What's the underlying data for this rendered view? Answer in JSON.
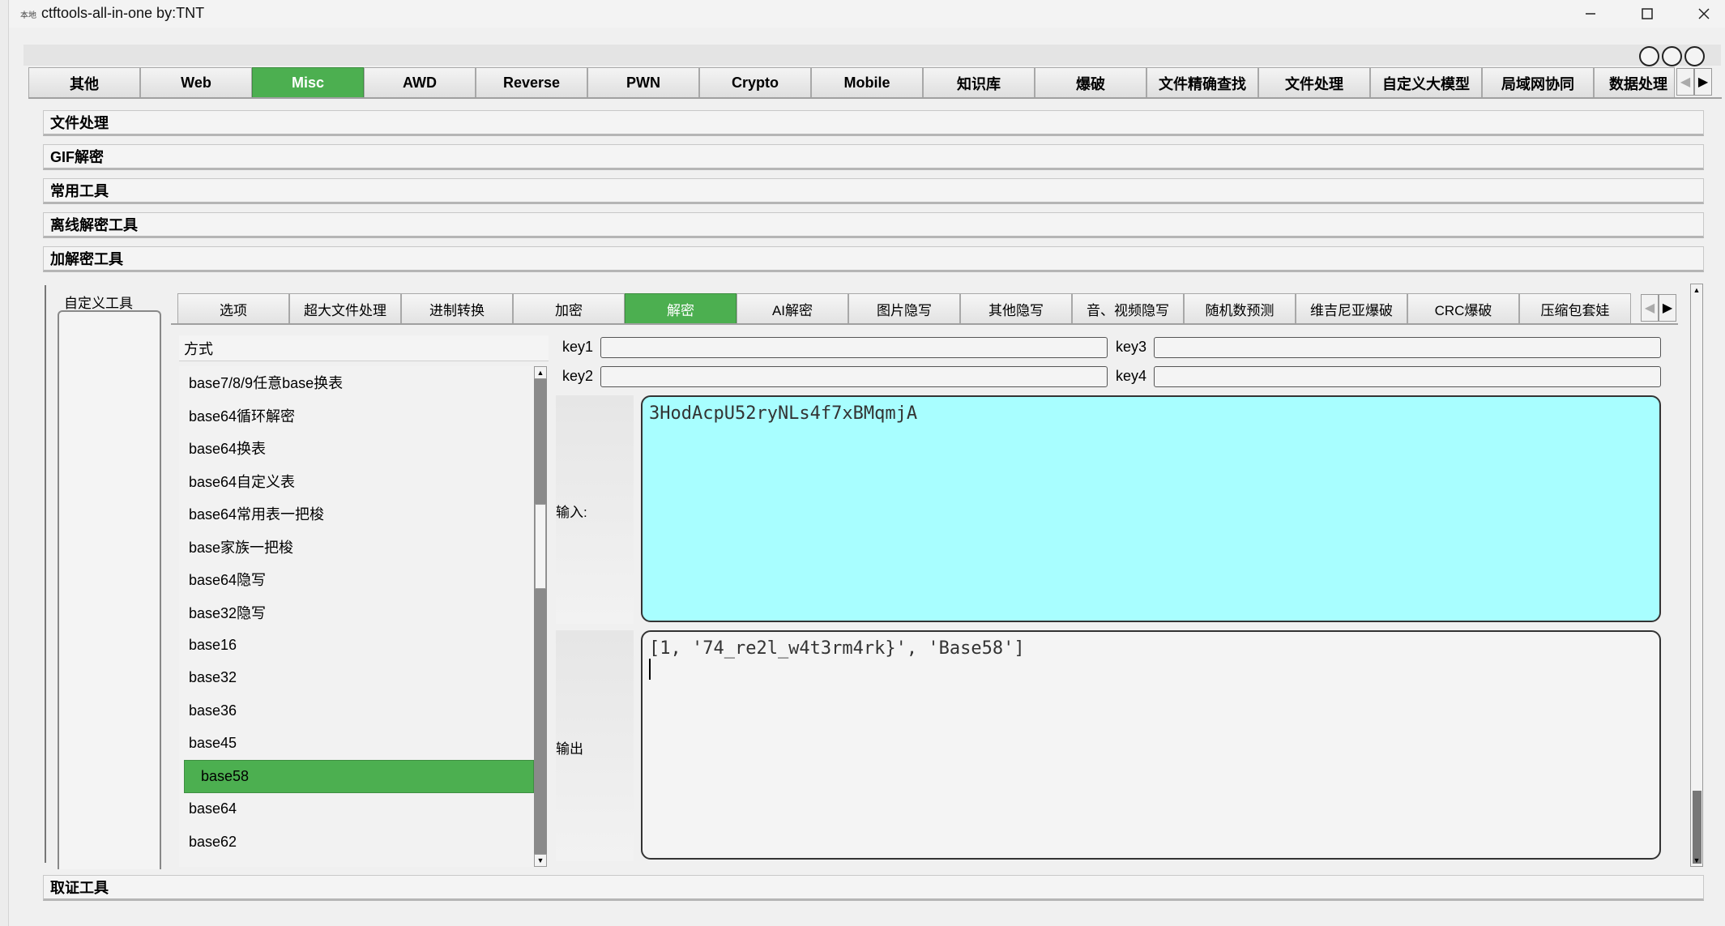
{
  "window": {
    "app_icon": "本地",
    "title": "ctftools-all-in-one   by:TNT"
  },
  "main_tabs": [
    {
      "label": "其他",
      "active": false
    },
    {
      "label": "Web",
      "active": false
    },
    {
      "label": "Misc",
      "active": true
    },
    {
      "label": "AWD",
      "active": false
    },
    {
      "label": "Reverse",
      "active": false
    },
    {
      "label": "PWN",
      "active": false
    },
    {
      "label": "Crypto",
      "active": false
    },
    {
      "label": "Mobile",
      "active": false
    },
    {
      "label": "知识库",
      "active": false
    },
    {
      "label": "爆破",
      "active": false
    },
    {
      "label": "文件精确查找",
      "active": false
    },
    {
      "label": "文件处理",
      "active": false
    },
    {
      "label": "自定义大模型",
      "active": false
    },
    {
      "label": "局域网协同",
      "active": false
    },
    {
      "label": "数据处理",
      "active": false
    }
  ],
  "sections": {
    "file_processing": "文件处理",
    "gif_decrypt": "GIF解密",
    "common_tools": "常用工具",
    "offline_decrypt": "离线解密工具",
    "crypto_tools": "加解密工具",
    "evidence_tools": "取证工具"
  },
  "custom_tool_label": "自定义工具",
  "sub_tabs": [
    {
      "label": "选项",
      "active": false
    },
    {
      "label": "超大文件处理",
      "active": false
    },
    {
      "label": "进制转换",
      "active": false
    },
    {
      "label": "加密",
      "active": false
    },
    {
      "label": "解密",
      "active": true
    },
    {
      "label": "AI解密",
      "active": false
    },
    {
      "label": "图片隐写",
      "active": false
    },
    {
      "label": "其他隐写",
      "active": false
    },
    {
      "label": "音、视频隐写",
      "active": false
    },
    {
      "label": "随机数预测",
      "active": false
    },
    {
      "label": "维吉尼亚爆破",
      "active": false
    },
    {
      "label": "CRC爆破",
      "active": false
    },
    {
      "label": "压缩包套娃",
      "active": false
    }
  ],
  "method_header": "方式",
  "methods": [
    {
      "label": "base7/8/9任意base换表",
      "selected": false
    },
    {
      "label": "base64循环解密",
      "selected": false
    },
    {
      "label": "base64换表",
      "selected": false
    },
    {
      "label": "base64自定义表",
      "selected": false
    },
    {
      "label": "base64常用表一把梭",
      "selected": false
    },
    {
      "label": "base家族一把梭",
      "selected": false
    },
    {
      "label": "base64隐写",
      "selected": false
    },
    {
      "label": "base32隐写",
      "selected": false
    },
    {
      "label": "base16",
      "selected": false
    },
    {
      "label": "base32",
      "selected": false
    },
    {
      "label": "base36",
      "selected": false
    },
    {
      "label": "base45",
      "selected": false
    },
    {
      "label": "base58",
      "selected": true
    },
    {
      "label": "base64",
      "selected": false
    },
    {
      "label": "base62",
      "selected": false
    }
  ],
  "keys": {
    "key1_label": "key1",
    "key1_value": "",
    "key2_label": "key2",
    "key2_value": "",
    "key3_label": "key3",
    "key3_value": "",
    "key4_label": "key4",
    "key4_value": ""
  },
  "io": {
    "input_label": "输入:",
    "input_value": "3HodAcpU52ryNLs4f7xBMqmjA",
    "output_label": "输出",
    "output_value": "[1, '74_re2l_w4t3rm4rk}', 'Base58']"
  },
  "colors": {
    "accent_green": "#4caf50",
    "input_bg": "#a8feff"
  }
}
